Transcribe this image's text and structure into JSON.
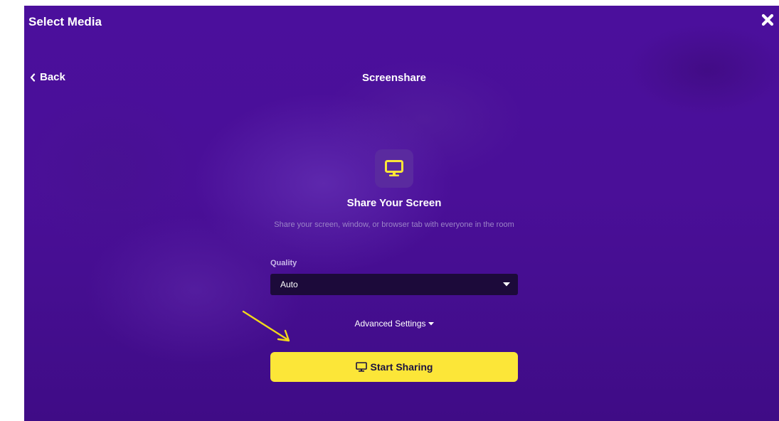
{
  "header": {
    "title": "Select Media",
    "close_icon": "close-x-icon"
  },
  "nav": {
    "back_label": "Back",
    "heading": "Screenshare"
  },
  "share_card": {
    "icon": "monitor-icon",
    "title": "Share Your Screen",
    "description": "Share your screen, window, or browser tab with everyone in the room"
  },
  "quality": {
    "label": "Quality",
    "selected": "Auto"
  },
  "advanced": {
    "label": "Advanced Settings"
  },
  "start_button": {
    "label": "Start Sharing",
    "icon": "monitor-icon"
  },
  "colors": {
    "background": "#4a0f98",
    "accent_yellow": "#fce638",
    "select_bg": "#1c0a3a",
    "annotation_arrow": "#f2d81a"
  }
}
